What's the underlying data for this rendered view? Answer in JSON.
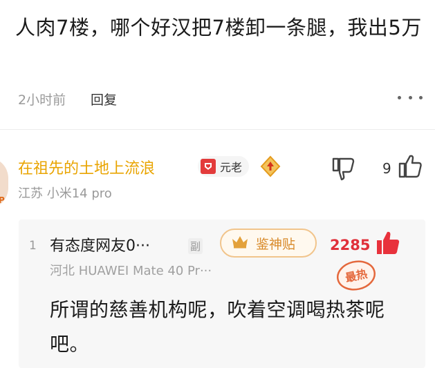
{
  "post": {
    "text": "人肉7楼，哪个好汉把7楼卸一条腿，我出5万",
    "time": "2小时前",
    "reply_label": "回复"
  },
  "comment": {
    "avatar_badge": "P",
    "username": "在祖先的土地上流浪",
    "role_badge": "元老",
    "like_count": "9",
    "location_device": "江苏  小米14 pro",
    "quote": {
      "index": "1",
      "username": "有态度网友0···",
      "sub_tag": "副",
      "badge": "鉴神贴",
      "like_count": "2285",
      "meta": "河北  HUAWEI Mate 40 Pr···",
      "hot_stamp": "最热",
      "text": "所谓的慈善机构呢，吹着空调喝热茶呢吧。"
    }
  },
  "colors": {
    "username": "#e9a400",
    "like_red": "#e0303a",
    "badge_orange": "#d88a2a"
  }
}
